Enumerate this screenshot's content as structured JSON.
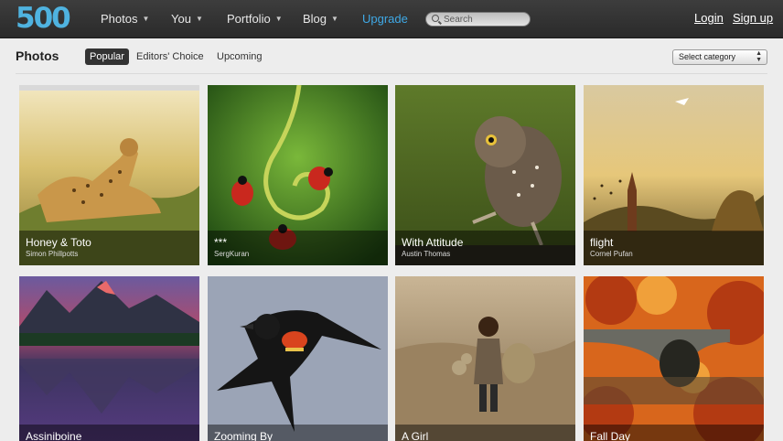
{
  "app": {
    "logo": "500"
  },
  "nav": {
    "items": [
      {
        "label": "Photos",
        "caret": "▼"
      },
      {
        "label": "You",
        "caret": "▼"
      },
      {
        "label": "Portfolio",
        "caret": "▼"
      },
      {
        "label": "Blog",
        "caret": "▼"
      }
    ],
    "upgrade": "Upgrade",
    "search_placeholder": "Search",
    "login": "Login",
    "signup": "Sign up"
  },
  "subheader": {
    "title": "Photos",
    "tabs": [
      {
        "label": "Popular",
        "active": true
      },
      {
        "label": "Editors' Choice",
        "active": false
      },
      {
        "label": "Upcoming",
        "active": false
      }
    ],
    "category_select": "Select category"
  },
  "photos": [
    {
      "title": "Honey & Toto",
      "author": "Simon Phillpotts",
      "subject": "cheetah"
    },
    {
      "title": "***",
      "author": "SergKuran",
      "subject": "ladybugs"
    },
    {
      "title": "With Attitude",
      "author": "Austin Thomas",
      "subject": "owl"
    },
    {
      "title": "flight",
      "author": "Cornel Pufan",
      "subject": "church-sunset"
    },
    {
      "title": "Assiniboine",
      "author": "",
      "subject": "mountain-lake"
    },
    {
      "title": "Zooming By",
      "author": "",
      "subject": "red-winged-blackbird"
    },
    {
      "title": "A Girl",
      "author": "",
      "subject": "girl-field"
    },
    {
      "title": "Fall Day",
      "author": "",
      "subject": "autumn-bridge"
    }
  ],
  "colors": {
    "accent": "#3fa9e6",
    "logo": "#4fb3e0",
    "topbar": "#333333"
  }
}
